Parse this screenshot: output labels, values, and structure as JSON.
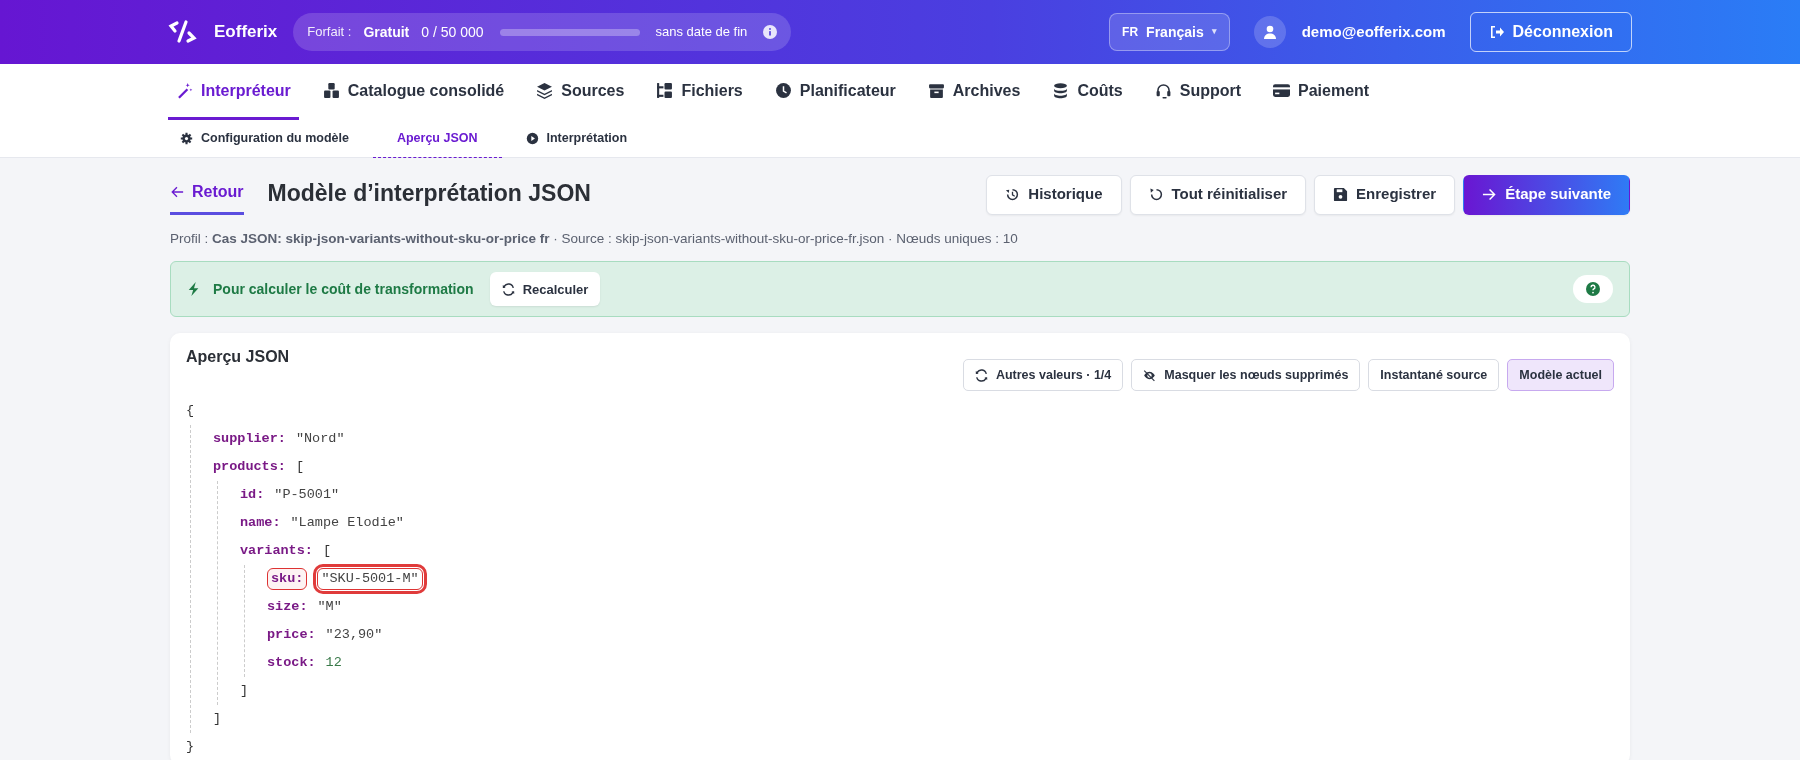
{
  "brand": {
    "name": "Eofferix"
  },
  "plan": {
    "label": "Forfait :",
    "name": "Gratuit",
    "usage": "0 / 50 000",
    "level": 0,
    "expiry": "sans date de fin"
  },
  "language": {
    "code": "FR",
    "name": "Français",
    "caret": "▾"
  },
  "user": {
    "email": "demo@eofferix.com"
  },
  "logout": {
    "label": "Déconnexion"
  },
  "tabs": [
    {
      "label": "Interpréteur",
      "selected": true
    },
    {
      "label": "Catalogue consolidé",
      "selected": false
    },
    {
      "label": "Sources",
      "selected": false
    },
    {
      "label": "Fichiers",
      "selected": false
    },
    {
      "label": "Planificateur",
      "selected": false
    },
    {
      "label": "Archives",
      "selected": false
    },
    {
      "label": "Coûts",
      "selected": false
    },
    {
      "label": "Support",
      "selected": false
    },
    {
      "label": "Paiement",
      "selected": false
    }
  ],
  "subtabs": [
    {
      "label": "Configuration du modèle",
      "selected": false
    },
    {
      "label": "Aperçu JSON",
      "selected": true
    },
    {
      "label": "Interprétation",
      "selected": false
    }
  ],
  "page": {
    "back": "Retour",
    "title": "Modèle d’interprétation JSON",
    "actions": [
      {
        "label": "Historique",
        "kind": "plain"
      },
      {
        "label": "Tout réinitialiser",
        "kind": "plain"
      },
      {
        "label": "Enregistrer",
        "kind": "plain"
      },
      {
        "label": "Étape suivante",
        "kind": "primary"
      }
    ],
    "meta": "Profil : **Cas JSON: skip-json-variants-without-sku-or-price fr** · Source : skip-json-variants-without-sku-or-price-fr.json · Nœuds uniques : 10"
  },
  "alert": {
    "text": "Pour calculer le coût de transformation",
    "button": "Recalculer"
  },
  "preview": {
    "title": "Aperçu JSON",
    "toolbar": [
      {
        "label": "Autres valeurs · 1/4",
        "kind": "action"
      },
      {
        "label": "Masquer les nœuds supprimés",
        "kind": "action"
      },
      {
        "label": "Instantané source",
        "kind": "toggle",
        "selected": false
      },
      {
        "label": "Modèle actuel",
        "kind": "toggle",
        "selected": true
      }
    ],
    "json": {
      "open": "{",
      "close": "}",
      "children": [
        {
          "key": "supplier:",
          "value": "\"Nord\"",
          "kind": "string",
          "flagged": false
        },
        {
          "key": "products:",
          "open": "[",
          "close": "]",
          "kind": "array",
          "children": [
            {
              "key": "id:",
              "value": "\"P-5001\"",
              "kind": "string",
              "flagged": false
            },
            {
              "key": "name:",
              "value": "\"Lampe Elodie\"",
              "kind": "string",
              "flagged": false
            },
            {
              "key": "variants:",
              "open": "[",
              "close": "]",
              "kind": "array",
              "children": [
                {
                  "key": "sku:",
                  "value": "\"SKU-5001-M\"",
                  "kind": "string",
                  "flagged": true
                },
                {
                  "key": "size:",
                  "value": "\"M\"",
                  "kind": "string",
                  "flagged": false
                },
                {
                  "key": "price:",
                  "value": "\"23,90\"",
                  "kind": "string",
                  "flagged": false
                },
                {
                  "key": "stock:",
                  "value": "12",
                  "kind": "number",
                  "flagged": false
                }
              ]
            }
          ]
        }
      ]
    }
  }
}
